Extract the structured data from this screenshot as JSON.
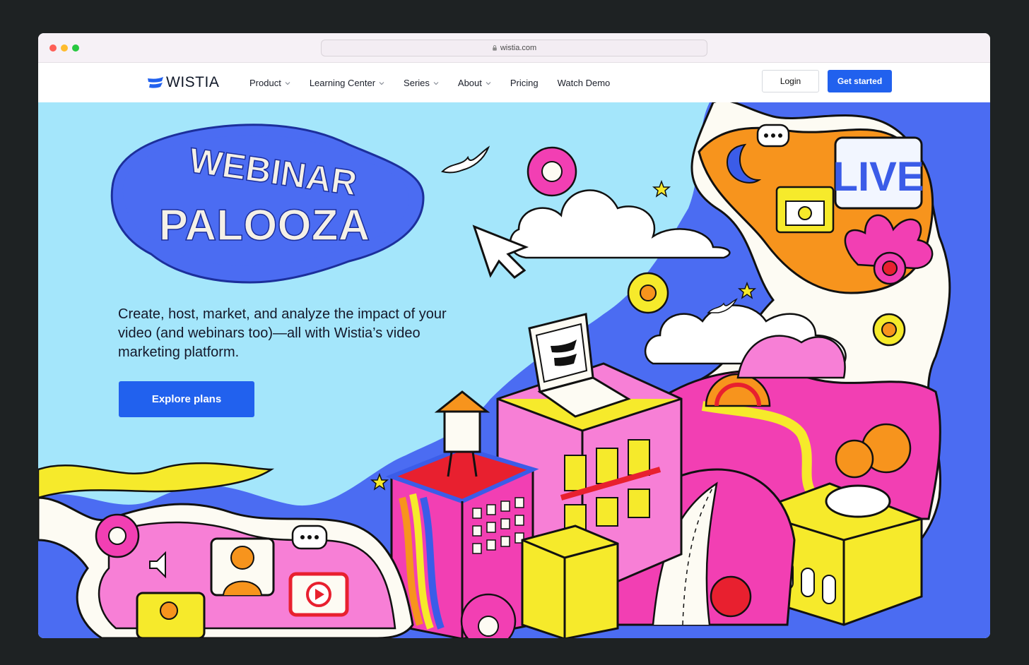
{
  "browser": {
    "url": "wistia.com"
  },
  "nav": {
    "brand": "WISTIA",
    "items": [
      {
        "label": "Product",
        "dropdown": true
      },
      {
        "label": "Learning Center",
        "dropdown": true
      },
      {
        "label": "Series",
        "dropdown": true
      },
      {
        "label": "About",
        "dropdown": true
      },
      {
        "label": "Pricing",
        "dropdown": false
      },
      {
        "label": "Watch Demo",
        "dropdown": false
      }
    ],
    "login_label": "Login",
    "get_started_label": "Get started"
  },
  "hero": {
    "logo_line1": "WEBINAR",
    "logo_line2": "PALOOZA",
    "live_sign": "LIVE",
    "description": "Create, host, market, and analyze the impact of your video (and webinars too)—all with Wistia’s video marketing platform.",
    "cta_label": "Explore plans"
  },
  "colors": {
    "brand_blue": "#2161ee",
    "sky": "#a4e6fb",
    "royal_blue": "#4b6cf2",
    "pink": "#f23fb3",
    "yellow": "#f6ea2b",
    "orange": "#f7941d"
  }
}
